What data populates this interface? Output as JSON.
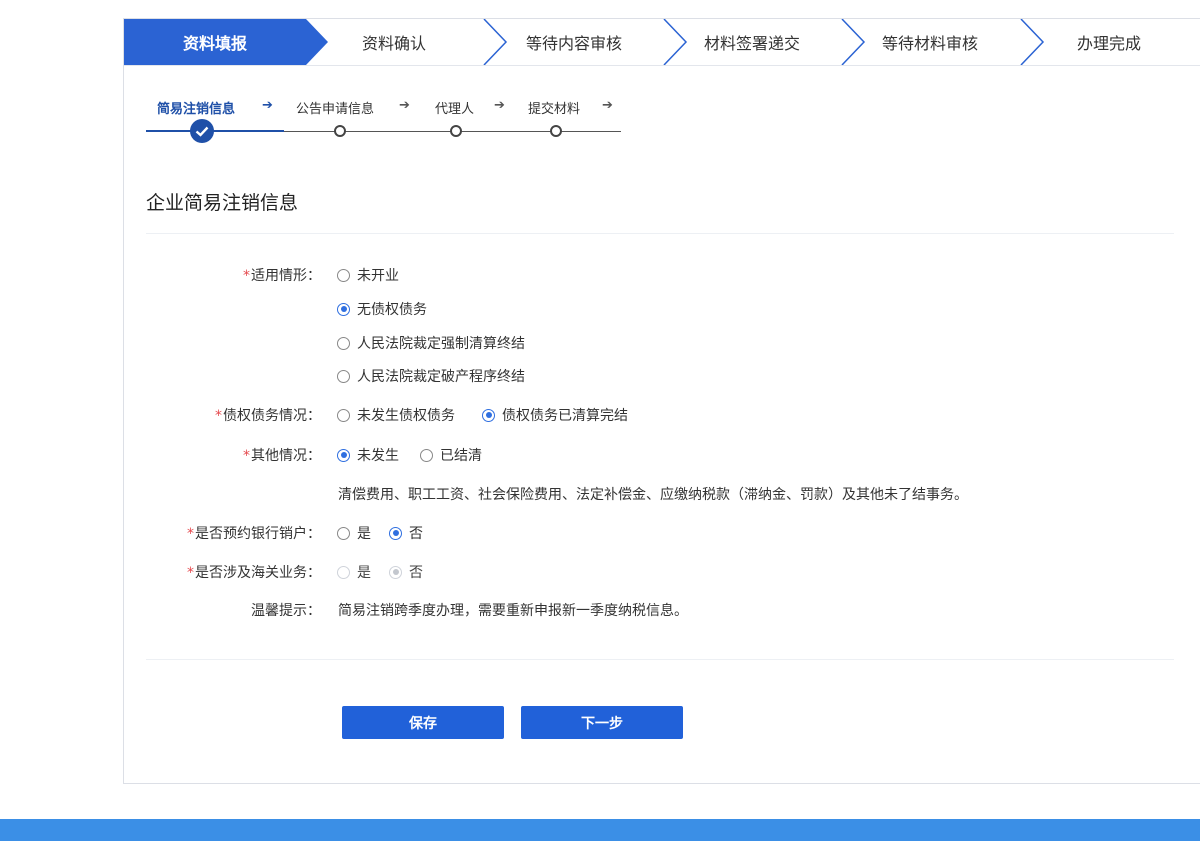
{
  "main_steps": [
    "资料填报",
    "资料确认",
    "等待内容审核",
    "材料签署递交",
    "等待材料审核",
    "办理完成"
  ],
  "sub_steps": [
    "简易注销信息",
    "公告申请信息",
    "代理人",
    "提交材料"
  ],
  "section_title": "企业简易注销信息",
  "form": {
    "applicable": {
      "label": "适用情形：",
      "options": [
        "未开业",
        "无债权债务",
        "人民法院裁定强制清算终结",
        "人民法院裁定破产程序终结"
      ],
      "selected": "无债权债务"
    },
    "debt": {
      "label": "债权债务情况：",
      "options": [
        "未发生债权债务",
        "债权债务已清算完结"
      ],
      "selected": "债权债务已清算完结"
    },
    "other": {
      "label": "其他情况：",
      "options": [
        "未发生",
        "已结清"
      ],
      "selected": "未发生",
      "note": "清偿费用、职工工资、社会保险费用、法定补偿金、应缴纳税款（滞纳金、罚款）及其他未了结事务。"
    },
    "bank": {
      "label": "是否预约银行销户：",
      "options": [
        "是",
        "否"
      ],
      "selected": "否"
    },
    "customs": {
      "label": "是否涉及海关业务：",
      "options": [
        "是",
        "否"
      ],
      "selected": "否"
    },
    "tip": {
      "label": "温馨提示：",
      "text": "简易注销跨季度办理，需要重新申报新一季度纳税信息。"
    }
  },
  "buttons": {
    "save": "保存",
    "next": "下一步"
  },
  "colors": {
    "primary": "#2161d9",
    "step_active": "#2b63d3",
    "required": "#e5484d",
    "footer": "#3b8fe6"
  }
}
